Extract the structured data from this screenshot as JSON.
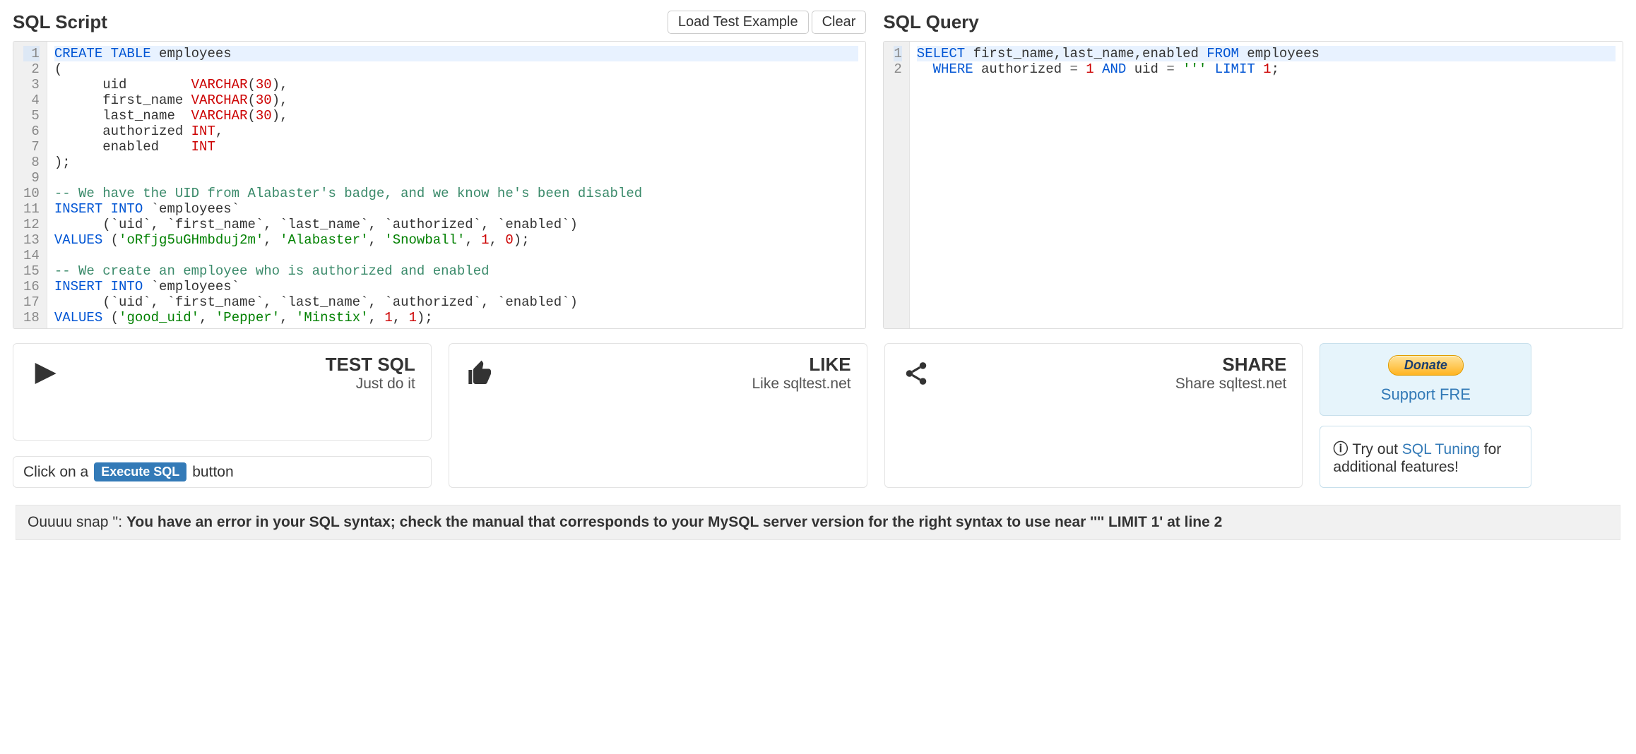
{
  "left": {
    "title": "SQL Script",
    "buttons": {
      "load": "Load Test Example",
      "clear": "Clear"
    },
    "code": [
      [
        {
          "t": "CREATE TABLE",
          "c": "kw"
        },
        {
          "t": " employees"
        }
      ],
      [
        {
          "t": "("
        }
      ],
      [
        {
          "t": "      uid        "
        },
        {
          "t": "VARCHAR",
          "c": "type"
        },
        {
          "t": "("
        },
        {
          "t": "30",
          "c": "num"
        },
        {
          "t": "),"
        }
      ],
      [
        {
          "t": "      first_name "
        },
        {
          "t": "VARCHAR",
          "c": "type"
        },
        {
          "t": "("
        },
        {
          "t": "30",
          "c": "num"
        },
        {
          "t": "),"
        }
      ],
      [
        {
          "t": "      last_name  "
        },
        {
          "t": "VARCHAR",
          "c": "type"
        },
        {
          "t": "("
        },
        {
          "t": "30",
          "c": "num"
        },
        {
          "t": "),"
        }
      ],
      [
        {
          "t": "      authorized "
        },
        {
          "t": "INT",
          "c": "type"
        },
        {
          "t": ","
        }
      ],
      [
        {
          "t": "      enabled    "
        },
        {
          "t": "INT",
          "c": "type"
        }
      ],
      [
        {
          "t": ");"
        }
      ],
      [],
      [
        {
          "t": "-- We have the UID from Alabaster's badge, and we know he's been disabled",
          "c": "cmt"
        }
      ],
      [
        {
          "t": "INSERT INTO",
          "c": "kw"
        },
        {
          "t": " `employees`"
        }
      ],
      [
        {
          "t": "      (`uid`, `first_name`, `last_name`, `authorized`, `enabled`)"
        }
      ],
      [
        {
          "t": "VALUES",
          "c": "kw"
        },
        {
          "t": " ("
        },
        {
          "t": "'oRfjg5uGHmbduj2m'",
          "c": "str"
        },
        {
          "t": ", "
        },
        {
          "t": "'Alabaster'",
          "c": "str"
        },
        {
          "t": ", "
        },
        {
          "t": "'Snowball'",
          "c": "str"
        },
        {
          "t": ", "
        },
        {
          "t": "1",
          "c": "num"
        },
        {
          "t": ", "
        },
        {
          "t": "0",
          "c": "num"
        },
        {
          "t": ");"
        }
      ],
      [],
      [
        {
          "t": "-- We create an employee who is authorized and enabled",
          "c": "cmt"
        }
      ],
      [
        {
          "t": "INSERT INTO",
          "c": "kw"
        },
        {
          "t": " `employees`"
        }
      ],
      [
        {
          "t": "      (`uid`, `first_name`, `last_name`, `authorized`, `enabled`)"
        }
      ],
      [
        {
          "t": "VALUES",
          "c": "kw"
        },
        {
          "t": " ("
        },
        {
          "t": "'good_uid'",
          "c": "str"
        },
        {
          "t": ", "
        },
        {
          "t": "'Pepper'",
          "c": "str"
        },
        {
          "t": ", "
        },
        {
          "t": "'Minstix'",
          "c": "str"
        },
        {
          "t": ", "
        },
        {
          "t": "1",
          "c": "num"
        },
        {
          "t": ", "
        },
        {
          "t": "1",
          "c": "num"
        },
        {
          "t": ");"
        }
      ]
    ]
  },
  "right": {
    "title": "SQL Query",
    "code": [
      [
        {
          "t": "SELECT",
          "c": "kw"
        },
        {
          "t": " first_name,last_name,enabled "
        },
        {
          "t": "FROM",
          "c": "kw"
        },
        {
          "t": " employees"
        }
      ],
      [
        {
          "t": "  "
        },
        {
          "t": "WHERE",
          "c": "kw"
        },
        {
          "t": " authorized "
        },
        {
          "t": "=",
          "c": "op"
        },
        {
          "t": " "
        },
        {
          "t": "1",
          "c": "num"
        },
        {
          "t": " "
        },
        {
          "t": "AND",
          "c": "kw"
        },
        {
          "t": " uid "
        },
        {
          "t": "=",
          "c": "op"
        },
        {
          "t": " "
        },
        {
          "t": "'''",
          "c": "str"
        },
        {
          "t": " "
        },
        {
          "t": "LIMIT",
          "c": "kw"
        },
        {
          "t": " "
        },
        {
          "t": "1",
          "c": "num"
        },
        {
          "t": ";"
        }
      ]
    ]
  },
  "cards": {
    "test": {
      "title": "TEST SQL",
      "sub": "Just do it"
    },
    "like": {
      "title": "LIKE",
      "sub": "Like sqltest.net"
    },
    "share": {
      "title": "SHARE",
      "sub": "Share sqltest.net"
    }
  },
  "hint": {
    "prefix": "Click on a ",
    "badge": "Execute SQL",
    "suffix": " button"
  },
  "donate": {
    "btn": "Donate",
    "support": "Support FRE"
  },
  "tuning": {
    "prefix": "Try out ",
    "link": "SQL Tuning",
    "suffix": " for additional features!"
  },
  "error": {
    "prefix": "Ouuuu snap '': ",
    "bold": "You have an error in your SQL syntax; check the manual that corresponds to your MySQL server version for the right syntax to use near '''' LIMIT 1' at line 2"
  }
}
